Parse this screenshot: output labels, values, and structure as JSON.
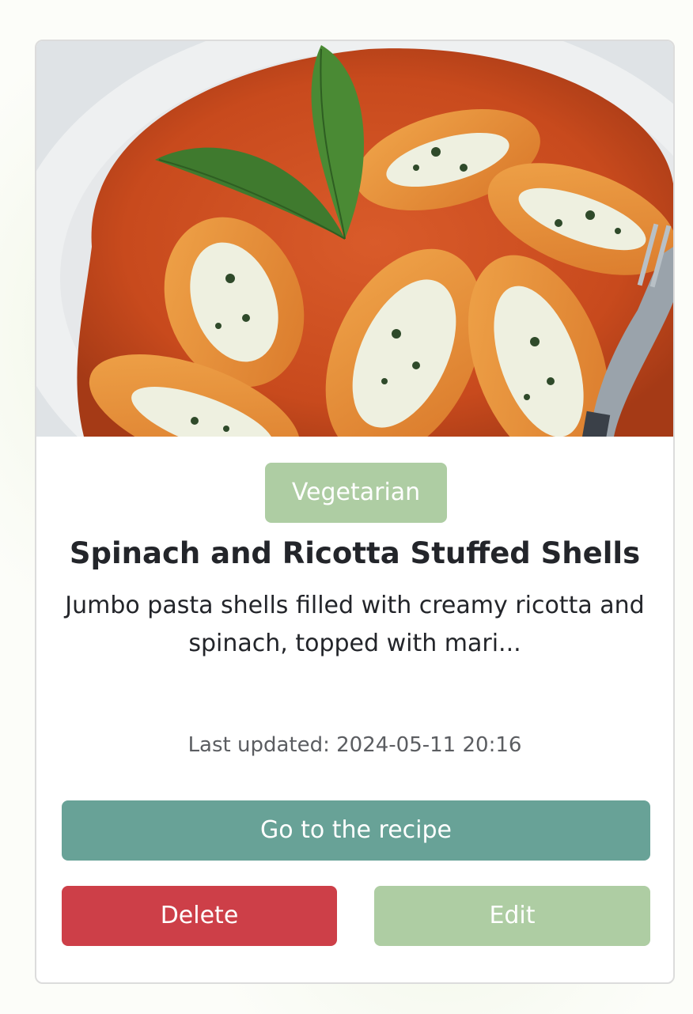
{
  "recipe_card": {
    "image_alt": "Spinach and Ricotta Stuffed Shells",
    "category_tag": "Vegetarian",
    "title": "Spinach and Ricotta Stuffed Shells",
    "description": "Jumbo pasta shells filled with creamy ricotta and spinach, topped with mari...",
    "last_updated": "Last updated: 2024-05-11 20:16",
    "go_button_label": "Go to the recipe",
    "delete_button_label": "Delete",
    "edit_button_label": "Edit"
  },
  "colors": {
    "tag_bg": "#aecda3",
    "go_button_bg": "#68a297",
    "delete_button_bg": "#cd3f48",
    "edit_button_bg": "#aecda3",
    "title_text": "#23252a"
  }
}
